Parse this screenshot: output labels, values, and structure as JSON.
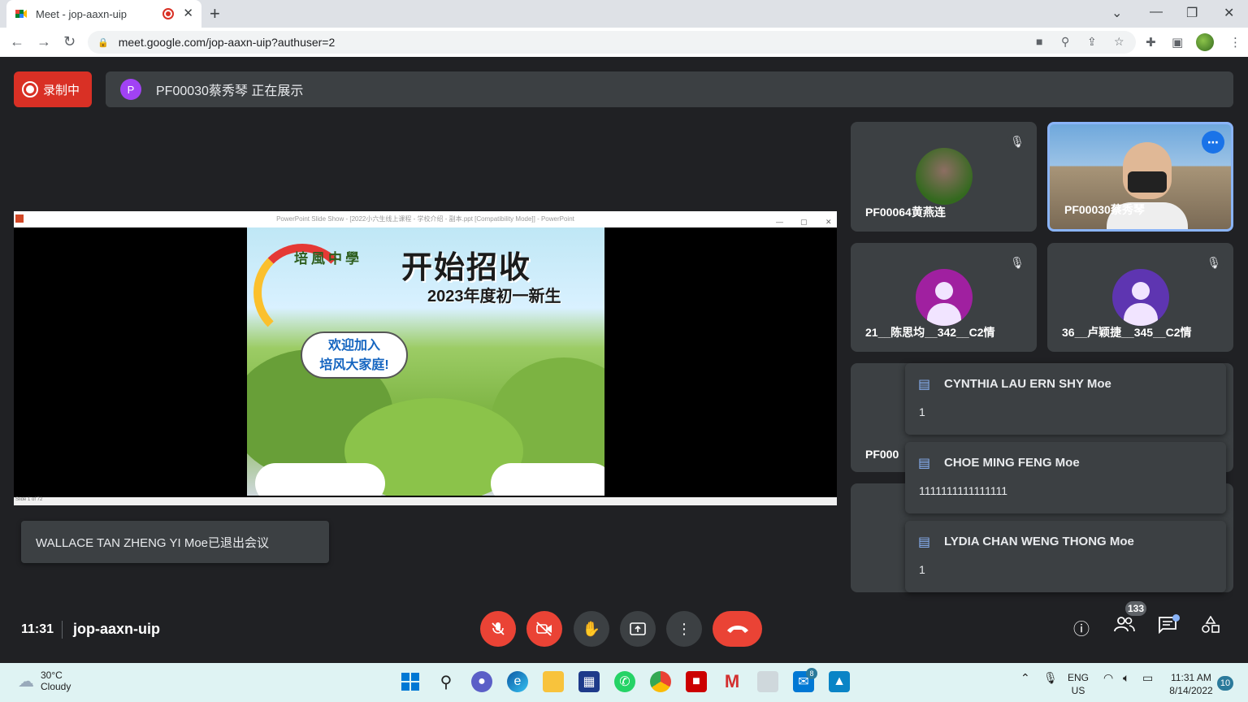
{
  "browser": {
    "tab_title": "Meet - jop-aaxn-uip",
    "url": "meet.google.com/jop-aaxn-uip?authuser=2"
  },
  "meet": {
    "recording_label": "录制中",
    "presenter_initial": "P",
    "presenting_text": "PF00030蔡秀琴 正在展示",
    "share_window_title": "PowerPoint Slide Show - [2022小六生线上课程 - 学校介绍 - 副本.ppt [Compatibility Mode]] - PowerPoint",
    "slide_status": "Slide 1 of 72",
    "slide": {
      "school_name": "培風中學",
      "headline": "开始招收",
      "subheadline": "2023年度初一新生",
      "bubble_line1": "欢迎加入",
      "bubble_line2": "培风大家庭!"
    },
    "toast": "WALLACE TAN ZHENG YI Moe已退出会议",
    "tiles": [
      {
        "name": "PF00064黄燕连",
        "avatar_color": "#4a7a3a"
      },
      {
        "name": "PF00030蔡秀琴",
        "avatar_color": "#8ab4f8"
      },
      {
        "name": "21__陈思均__342__C2情",
        "avatar_color": "#a020a0"
      },
      {
        "name": "36__卢颖捷__345__C2情",
        "avatar_color": "#5e35b1"
      },
      {
        "name": "PF000"
      }
    ],
    "more_options_icon": "⋯",
    "chat_notices": [
      {
        "sender": "CYNTHIA LAU ERN SHY Moe",
        "message": "1"
      },
      {
        "sender": "CHOE MING FENG Moe",
        "message": "1111111111111111"
      },
      {
        "sender": "LYDIA CHAN WENG THONG Moe",
        "message": "1"
      }
    ],
    "clock": "11:31",
    "meeting_code": "jop-aaxn-uip",
    "participants_count": "133"
  },
  "taskbar": {
    "temp": "30°C",
    "condition": "Cloudy",
    "lang1": "ENG",
    "lang2": "US",
    "time": "11:31 AM",
    "date": "8/14/2022",
    "notifications": "10",
    "mail_badge": "8"
  }
}
